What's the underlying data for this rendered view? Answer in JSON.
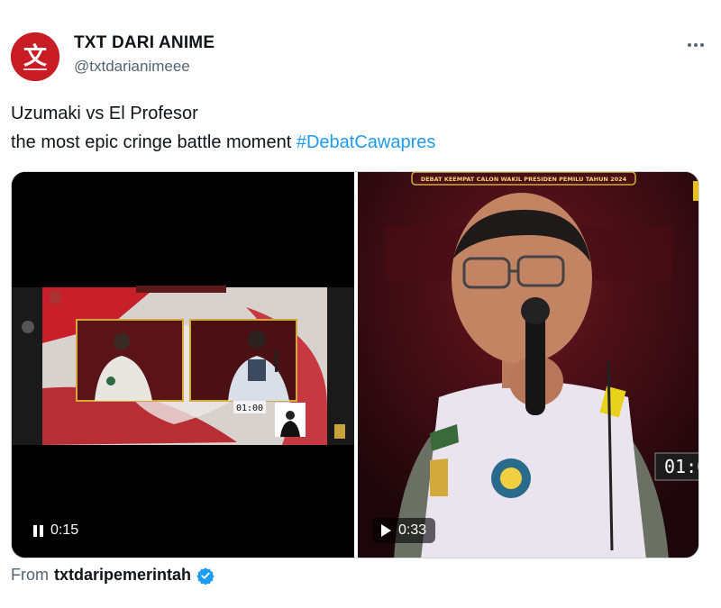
{
  "author": {
    "display_name": "TXT DARI ANIME",
    "handle": "@txtdarianimeee",
    "avatar_text": "文"
  },
  "tweet": {
    "line1": "Uzumaki vs El Profesor",
    "line2_text": "the most epic cringe battle moment ",
    "hashtag": "#DebatCawapres"
  },
  "media": {
    "videos": [
      {
        "time": "0:15",
        "state": "playing",
        "inner_clock": "01:00"
      },
      {
        "time": "0:33",
        "state": "paused",
        "banner": "DEBAT KEEMPAT CALON WAKIL PRESIDEN PEMILU TAHUN 2024",
        "clock": "01:0"
      }
    ]
  },
  "attribution": {
    "label": "From",
    "user": "txtdaripemerintah"
  },
  "colors": {
    "link": "#1d9bf0",
    "secondary_text": "#536471",
    "avatar_bg": "#c81d25",
    "verified": "#1d9bf0"
  }
}
